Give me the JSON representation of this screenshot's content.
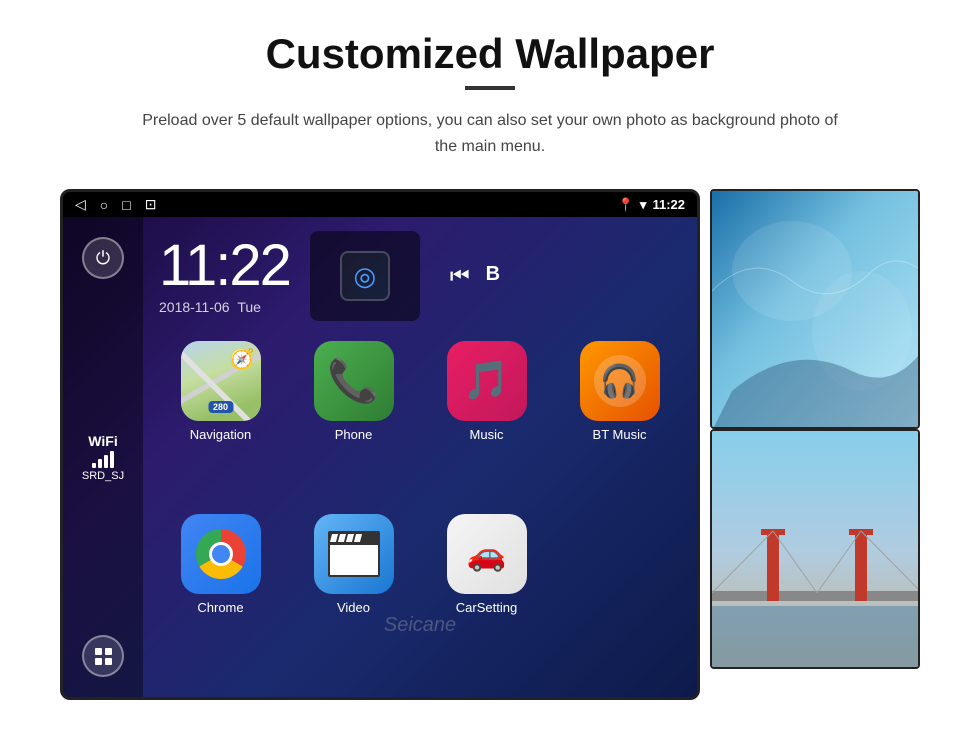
{
  "page": {
    "title": "Customized Wallpaper",
    "subtitle": "Preload over 5 default wallpaper options, you can also set your own photo as background photo of the main menu.",
    "divider": true
  },
  "device": {
    "statusBar": {
      "navBack": "◁",
      "navHome": "○",
      "navRecent": "□",
      "navCapture": "⊡",
      "locationIcon": "📍",
      "wifiIcon": "▾",
      "time": "11:22"
    },
    "clock": {
      "time": "11:22",
      "date": "2018-11-06",
      "day": "Tue"
    },
    "sidebar": {
      "wifiLabel": "WiFi",
      "wifiNetwork": "SRD_SJ"
    },
    "apps": [
      {
        "id": "navigation",
        "label": "Navigation",
        "shieldText": "280",
        "type": "navigation"
      },
      {
        "id": "phone",
        "label": "Phone",
        "type": "phone"
      },
      {
        "id": "music",
        "label": "Music",
        "type": "music"
      },
      {
        "id": "btmusic",
        "label": "BT Music",
        "type": "btmusic"
      },
      {
        "id": "chrome",
        "label": "Chrome",
        "type": "chrome"
      },
      {
        "id": "video",
        "label": "Video",
        "type": "video"
      },
      {
        "id": "carsetting",
        "label": "CarSetting",
        "type": "carsetting"
      }
    ],
    "watermark": "Seicane"
  }
}
